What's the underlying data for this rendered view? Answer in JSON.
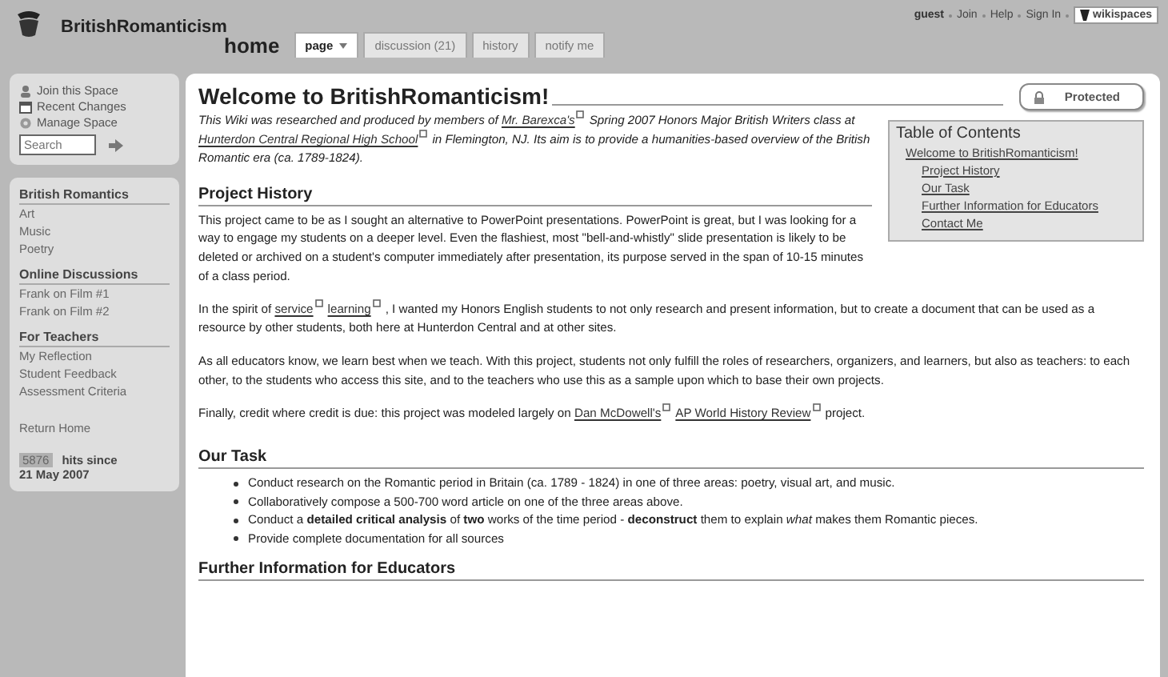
{
  "header": {
    "site_title": "BritishRomanticism",
    "page_name": "home",
    "tabs": [
      {
        "label": "page",
        "selected": true,
        "kind": "menu"
      },
      {
        "label": "discussion (21)",
        "selected": false,
        "kind": "plain"
      },
      {
        "label": "history",
        "selected": false,
        "kind": "plain"
      },
      {
        "label": "notify me",
        "selected": false,
        "kind": "plain"
      }
    ],
    "user": "guest",
    "user_links": [
      "Join",
      "Help",
      "Sign In"
    ],
    "brand": "wikispaces"
  },
  "sidebar": {
    "actions": [
      {
        "kind": "join",
        "label": "Join this Space"
      },
      {
        "kind": "changes",
        "label": "Recent Changes"
      },
      {
        "kind": "manage",
        "label": "Manage Space"
      }
    ],
    "search": {
      "placeholder": "Search"
    },
    "sections": [
      {
        "heading": "British Romantics",
        "items": [
          "Art",
          "Music",
          "Poetry"
        ]
      },
      {
        "heading": "Online Discussions",
        "items": [
          "Frank on Film #1",
          "Frank on Film #2"
        ]
      },
      {
        "heading": "For Teachers",
        "items": [
          "My Reflection",
          "Student Feedback",
          "Assessment Criteria"
        ]
      }
    ],
    "return_link": "Return Home",
    "hits": {
      "count": "5876",
      "label": "hits since",
      "date": "21 May 2007"
    }
  },
  "main": {
    "title": "Welcome to BritishRomanticism!",
    "protected": "Protected",
    "intro": [
      {
        "kind": "text",
        "text": "This Wiki was researched and produced by members of"
      },
      {
        "kind": "link",
        "text": "Mr. Barexca's"
      },
      {
        "kind": "text",
        "text": "Spring 2007 Honors Major British Writers class at"
      },
      {
        "kind": "link",
        "text": "Hunterdon Central Regional High School"
      },
      {
        "kind": "text",
        "text": "in Flemington, NJ. Its aim is to provide a humanities-based overview of the British Romantic era (ca. 1789-1824)."
      }
    ],
    "toc": {
      "title": "Table of Contents",
      "items": [
        {
          "label": "Welcome to BritishRomanticism!",
          "children": [
            {
              "label": "Project History"
            },
            {
              "label": "Our Task"
            },
            {
              "label": "Further Information for Educators"
            },
            {
              "label": "Contact Me"
            }
          ]
        }
      ]
    },
    "sections": [
      {
        "heading": "Project History",
        "paragraphs": [
          [
            {
              "kind": "text",
              "text": "This project came to be as I sought an alternative to PowerPoint presentations. PowerPoint is great, but I was looking for a way to engage my students on a deeper level. Even the flashiest, most \"bell-and-whistly\" slide presentation is likely to be deleted or archived on a student's computer immediately after presentation, its purpose served in the span of 10-15 minutes of a class period."
            }
          ],
          [
            {
              "kind": "text",
              "text": "In the spirit of"
            },
            {
              "kind": "link",
              "text": "service"
            },
            {
              "kind": "link",
              "text": "learning"
            },
            {
              "kind": "text",
              "text": ", I wanted my Honors English students to not only research and present information, but to create a document that can be used as a resource by other students, both here at Hunterdon Central and at other sites."
            }
          ],
          [
            {
              "kind": "text",
              "text": "As all educators know, we learn best when we teach. With this project, students not only fulfill the roles of researchers, organizers, and learners, but also as teachers: to each other, to the students who access this site, and to the teachers who use this as a sample upon which to base their own projects."
            }
          ],
          [
            {
              "kind": "text",
              "text": "Finally, credit where credit is due: this project was modeled largely on"
            },
            {
              "kind": "link",
              "text": "Dan McDowell's"
            },
            {
              "kind": "link",
              "text": "AP World History Review"
            },
            {
              "kind": "text",
              "text": "project."
            }
          ]
        ]
      },
      {
        "heading": "Our Task",
        "bullets": [
          "Conduct research on the Romantic period in Britain (ca. 1789 - 1824) in one of three areas: poetry, visual art, and music.",
          "Collaboratively compose a 500-700 word article on one of the three areas above.",
          "Conduct a **detailed critical analysis** of **two** works of the time period - **deconstruct** them to explain *what* makes them Romantic pieces.",
          "Provide complete documentation for all sources"
        ]
      },
      {
        "heading": "Further Information for Educators"
      }
    ]
  }
}
